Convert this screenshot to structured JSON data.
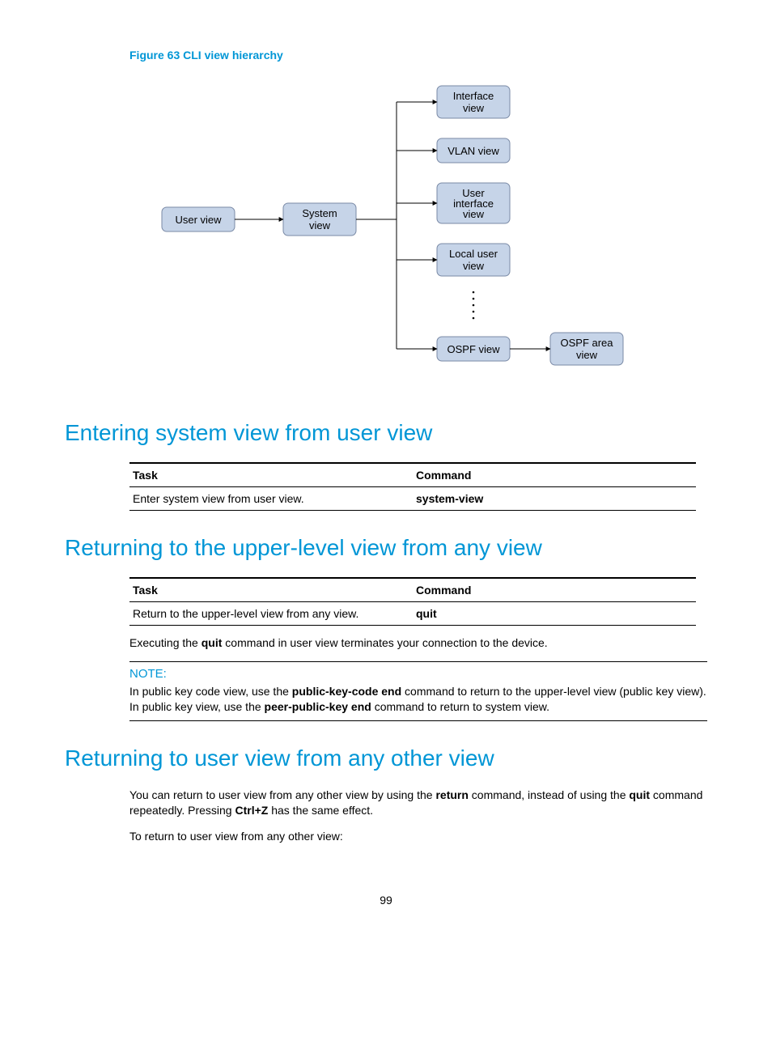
{
  "figure": {
    "caption": "Figure 63 CLI view hierarchy",
    "nodes": {
      "user_view": "User view",
      "system_view": "System view",
      "interface_view": "Interface view",
      "vlan_view": "VLAN view",
      "user_interface_view": "User interface view",
      "local_user_view": "Local user view",
      "ospf_view": "OSPF view",
      "ospf_area_view": "OSPF area view"
    }
  },
  "sections": {
    "s1": {
      "heading": "Entering system view from user view",
      "table": {
        "th_task": "Task",
        "th_cmd": "Command",
        "row_task": "Enter system view from user view.",
        "row_cmd": "system-view"
      }
    },
    "s2": {
      "heading": "Returning to the upper-level view from any view",
      "table": {
        "th_task": "Task",
        "th_cmd": "Command",
        "row_task": "Return to the upper-level view from any view.",
        "row_cmd": "quit"
      },
      "para_pre": "Executing the ",
      "para_bold1": "quit",
      "para_post": " command in user view terminates your connection to the device.",
      "note_label": "NOTE:",
      "note_pre": "In public key code view, use the ",
      "note_b1": "public-key-code end",
      "note_mid": " command to return to the upper-level view (public key view). In public key view, use the ",
      "note_b2": "peer-public-key end",
      "note_post": " command to return to system view."
    },
    "s3": {
      "heading": "Returning to user view from any other view",
      "p1_a": "You can return to user view from any other view by using the ",
      "p1_b1": "return",
      "p1_b": " command, instead of using the ",
      "p1_b2": "quit",
      "p1_c": " command repeatedly. Pressing ",
      "p1_b3": "Ctrl+Z",
      "p1_d": " has the same effect.",
      "p2": "To return to user view from any other view:"
    }
  },
  "page_number": "99"
}
